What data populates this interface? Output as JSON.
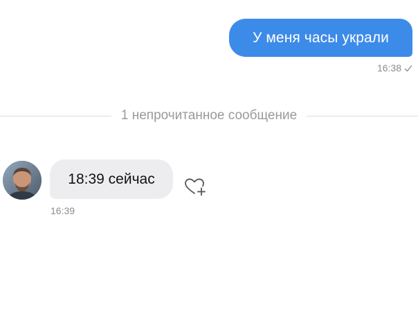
{
  "outgoing_message": {
    "text": "У меня часы украли",
    "time": "16:38",
    "status_icon": "check-icon",
    "bubble_color": "#3d8be8"
  },
  "unread_separator": {
    "text": "1 непрочитанное сообщение"
  },
  "incoming_message": {
    "text": "18:39 сейчас",
    "time": "16:39",
    "avatar": "sender-avatar",
    "reaction_icon": "heart-plus-icon",
    "bubble_color": "#ededf0"
  }
}
